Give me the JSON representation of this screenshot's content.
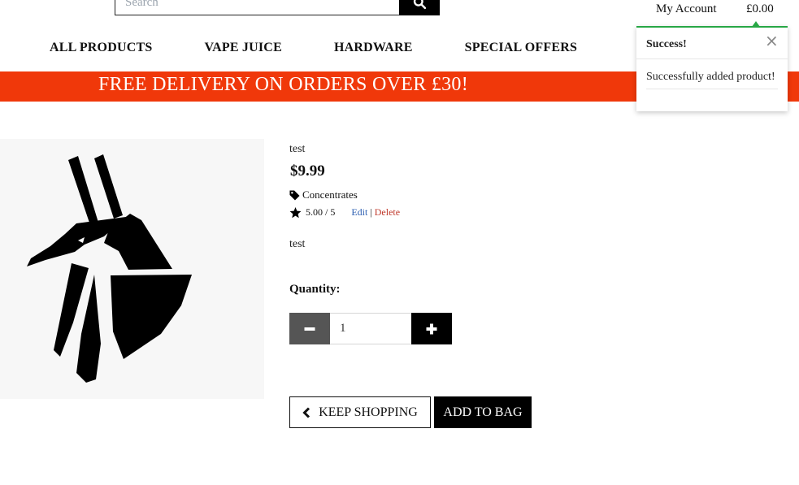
{
  "header": {
    "search_placeholder": "Search",
    "my_account": "My Account",
    "bag_total": "£0.00"
  },
  "nav": {
    "items": [
      "ALL PRODUCTS",
      "VAPE JUICE",
      "HARDWARE",
      "SPECIAL OFFERS"
    ]
  },
  "banner": {
    "text": "FREE DELIVERY ON ORDERS OVER £30!",
    "color": "#f0380a"
  },
  "toast": {
    "title": "Success!",
    "close": "×",
    "message": "Successfully added product!",
    "accent": "#28a745"
  },
  "product": {
    "image_icon": "anubis-logo-icon",
    "name": "test",
    "price": "$9.99",
    "category_icon": "tag-icon",
    "category": "Concentrates",
    "rating_icon": "star-icon",
    "rating": "5.00 / 5",
    "edit_label": "Edit",
    "separator": "|",
    "delete_label": "Delete",
    "description": "test"
  },
  "quantity": {
    "label": "Quantity:",
    "value": "1"
  },
  "actions": {
    "keep_shopping": "KEEP SHOPPING",
    "add_to_bag": "ADD TO BAG"
  }
}
